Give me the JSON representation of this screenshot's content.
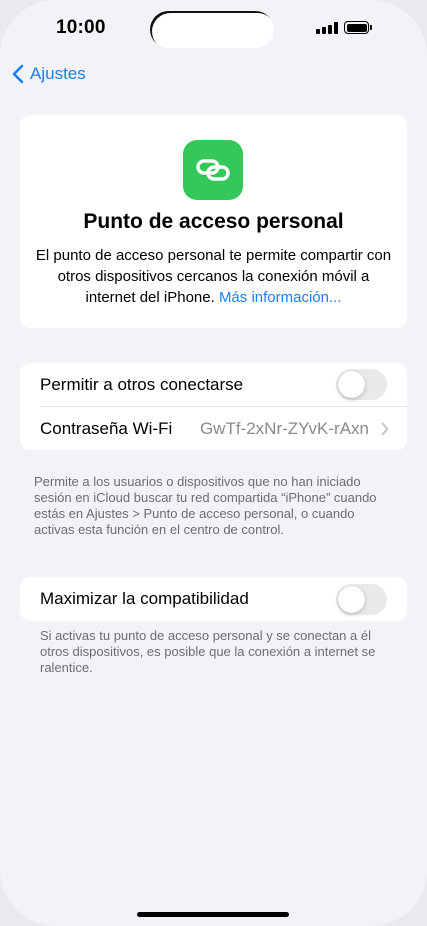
{
  "status_bar": {
    "time": "10:00",
    "signal_icon": "cellular-signal-icon",
    "battery_icon": "battery-icon"
  },
  "nav": {
    "back_label": "Ajustes",
    "back_icon": "chevron-left-icon"
  },
  "hero": {
    "icon": "link-chain-icon",
    "icon_color": "#34c759",
    "title": "Punto de acceso personal",
    "description": "El punto de acceso personal te permite compartir con otros dispositivos cercanos la conexión móvil a internet del iPhone.",
    "more_link": "Más información..."
  },
  "settings": {
    "allow_others": {
      "label": "Permitir a otros conectarse",
      "enabled": false
    },
    "wifi_password": {
      "label": "Contraseña Wi-Fi",
      "value": "GwTf-2xNr-ZYvK-rAxn"
    },
    "footnote_1": "Permite a los usuarios o dispositivos que no han iniciado sesión en iCloud buscar tu red compartida “iPhone” cuando estás en Ajustes > Punto de acceso personal, o cuando activas esta función en el centro de control.",
    "maximize_compat": {
      "label": "Maximizar la compatibilidad",
      "enabled": false
    },
    "footnote_2": "Si activas tu punto de acceso personal y se conectan a él otros dispositivos, es posible que la conexión a internet se ralentice."
  },
  "colors": {
    "accent": "#1a7ff2",
    "background": "#f2f2f7",
    "toggle_off": "#e9e9eb"
  }
}
